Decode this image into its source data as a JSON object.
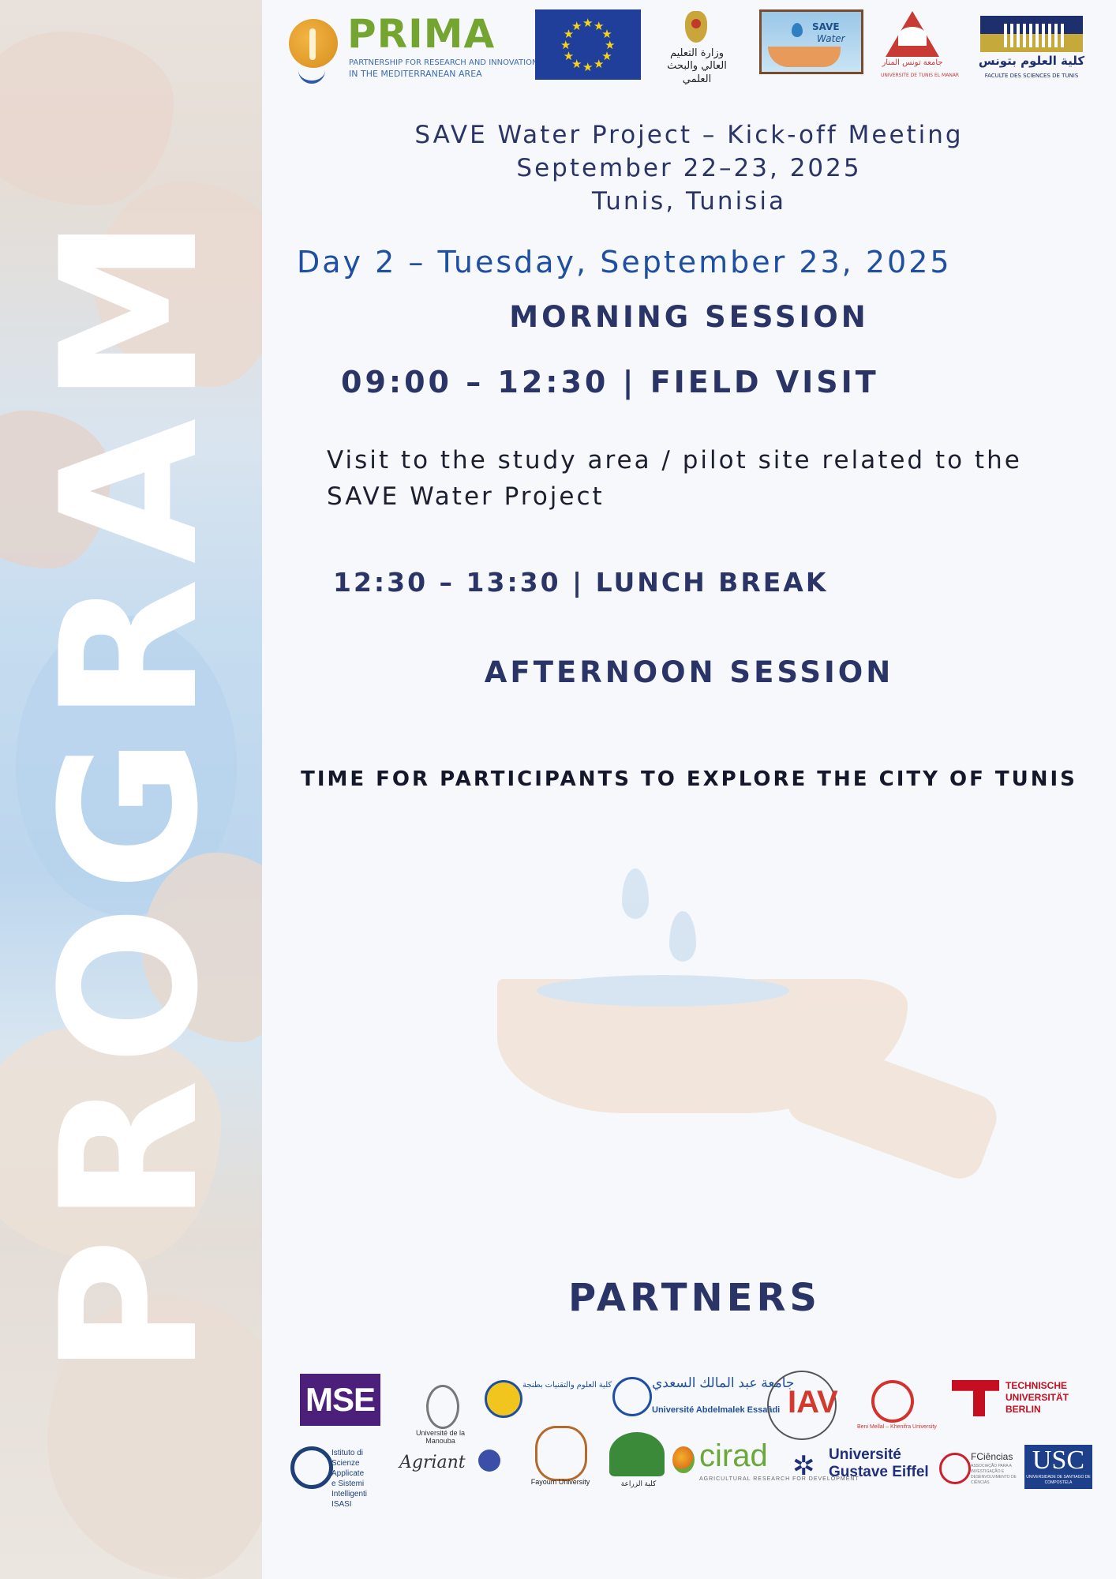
{
  "side_banner": {
    "word": "PROGRAM"
  },
  "logos": {
    "prima": {
      "name": "PRIMA",
      "tagline_1": "PARTNERSHIP FOR RESEARCH AND INNOVATION",
      "tagline_2": "IN THE MEDITERRANEAN AREA"
    },
    "ministry": {
      "arabic": "وزارة التعليم العالي والبحث العلمي"
    },
    "save_water": {
      "line1": "SAVE",
      "line2": "Water"
    },
    "utm": {
      "arabic": "جامعة تونس المنار",
      "french": "UNIVERSITE DE TUNIS EL MANAR"
    },
    "fst": {
      "arabic": "كلية العلوم بتونس",
      "french": "FACULTE DES SCIENCES DE TUNIS"
    }
  },
  "header": {
    "line1": "SAVE Water Project – Kick-off Meeting",
    "line2": "September 22–23, 2025",
    "line3": "Tunis, Tunisia"
  },
  "day_heading": "Day 2 – Tuesday, September 23, 2025",
  "morning": {
    "title": "MORNING SESSION",
    "slot1": "09:00 – 12:30 | FIELD VISIT",
    "slot1_desc": "Visit to the study area / pilot site related to the SAVE Water Project",
    "slot2": "12:30 – 13:30 | LUNCH BREAK"
  },
  "afternoon": {
    "title": "AFTERNOON SESSION",
    "text": "TIME FOR PARTICIPANTS TO EXPLORE THE CITY OF TUNIS"
  },
  "partners": {
    "title": "PARTNERS",
    "mse": "MSE",
    "manouba": "Université de la Manouba",
    "fstt": "كلية العلوم والتقنيات بطنجة",
    "uae_ar": "جامعة عبد المالك السعدي",
    "uae_fr": "Université Abdelmalek Essaâdi",
    "iav": "IAV",
    "beni": "Beni Mellal – Khenifra University",
    "tub": [
      "TECHNISCHE",
      "UNIVERSITÄT",
      "BERLIN"
    ],
    "isasi": [
      "Istituto di",
      "Scienze Applicate",
      "e Sistemi Intelligenti",
      "ISASI"
    ],
    "agriant": "Agriant",
    "fayoum": "Fayoum University",
    "agro": "كلية الزراعة",
    "cirad": "cirad",
    "cirad_sub": "AGRICULTURAL RESEARCH FOR DEVELOPMENT",
    "uge": [
      "Université",
      "Gustave Eiffel"
    ],
    "fciencias": "FCiências",
    "fciencias_sub": "ASSOCIAÇÃO PARA A INVESTIGAÇÃO E DESENVOLVIMENTO DE CIÊNCIAS",
    "usc": "USC",
    "usc_sub": "UNIVERSIDADE DE SANTIAGO DE COMPOSTELA"
  }
}
